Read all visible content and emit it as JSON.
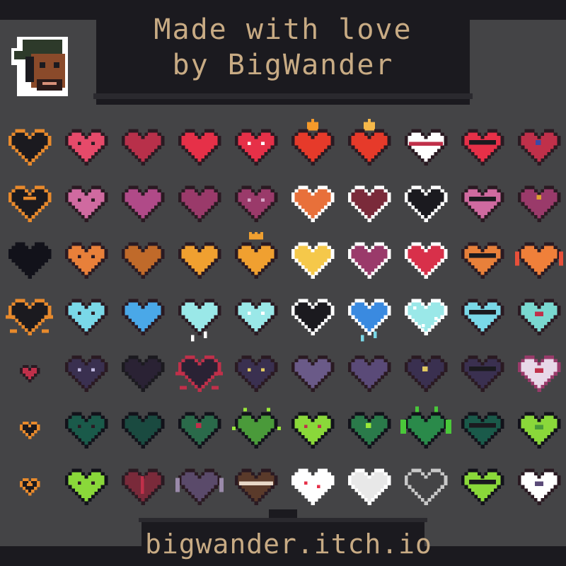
{
  "header": {
    "title_line1": "Made with love",
    "title_line2": "by BigWander"
  },
  "avatar": {
    "name": "avatar-icon"
  },
  "footer": {
    "url": "bigwander.itch.io"
  },
  "colors": {
    "outer_bg": "#1b1a1f",
    "panel_bg": "#444446",
    "panel_border": "#2a292e",
    "title_text": "#c8ab84",
    "plate_bg": "#1b1a1f"
  },
  "hearts": [
    [
      {
        "fill": "#1b1a1f",
        "outline": "#e88a2c"
      },
      {
        "fill": "#e64a6a",
        "outline": "#2a1a22",
        "eyes": "#2a1a22"
      },
      {
        "fill": "#b8304a",
        "outline": "#2a1a22"
      },
      {
        "fill": "#e63048",
        "outline": "#2a1a22"
      },
      {
        "fill": "#e63048",
        "outline": "#2a1a22",
        "eyes": "#ffffff"
      },
      {
        "fill": "#e63a2a",
        "outline": "#2a1a22",
        "flame": "#f59a2a"
      },
      {
        "fill": "#e63a2a",
        "outline": "#2a1a22",
        "flame": "#f5b84a"
      },
      {
        "fill": "#ffffff",
        "outline": "#2a1a22",
        "band": "#c0304a"
      },
      {
        "fill": "#e63048",
        "outline": "#2a1a22",
        "glasses": "#1b1a1f"
      },
      {
        "fill": "#c0304a",
        "outline": "#2a1a22",
        "eye": "#3a4aa8"
      }
    ],
    [
      {
        "fill": "#1b1a1f",
        "outline": "#e88a2c",
        "double": true
      },
      {
        "fill": "#d06aa0",
        "outline": "#2a1a22",
        "eyes": "#2a1a22"
      },
      {
        "fill": "#b04a88",
        "outline": "#2a1a22"
      },
      {
        "fill": "#9a3a6a",
        "outline": "#2a1a22"
      },
      {
        "fill": "#9a3a6a",
        "outline": "#2a1a22",
        "eyes": "#d8a8c8"
      },
      {
        "fill": "#e8703a",
        "outline": "#ffffff"
      },
      {
        "fill": "#7a2a3a",
        "outline": "#ffffff"
      },
      {
        "fill": "#1b1a1f",
        "outline": "#ffffff"
      },
      {
        "fill": "#d06aa0",
        "outline": "#2a1a22",
        "glasses": "#1b1a1f"
      },
      {
        "fill": "#9a3a6a",
        "outline": "#2a1a22",
        "bow": "#e0a030"
      }
    ],
    [
      {
        "fill": "#12121a",
        "outline": "#12121a"
      },
      {
        "fill": "#e8803a",
        "outline": "#2a1a22",
        "eyes": "#2a1a22"
      },
      {
        "fill": "#c06a2a",
        "outline": "#2a1a22"
      },
      {
        "fill": "#f0a030",
        "outline": "#2a1a22"
      },
      {
        "fill": "#f0a030",
        "outline": "#2a1a22",
        "crown": "#f0a030"
      },
      {
        "fill": "#f5c84a",
        "outline": "#ffffff"
      },
      {
        "fill": "#9a3a6a",
        "outline": "#ffffff"
      },
      {
        "fill": "#d8304a",
        "outline": "#ffffff"
      },
      {
        "fill": "#e8803a",
        "outline": "#2a1a22",
        "glasses": "#1b1a1f"
      },
      {
        "fill": "#f0803a",
        "outline": "#2a1a22",
        "wings": "#e8503a"
      }
    ],
    [
      {
        "fill": "#1b1a1f",
        "outline": "#e88a2c",
        "spikes": true
      },
      {
        "fill": "#7ad8e8",
        "outline": "#2a1a22",
        "eyes": "#2a1a22"
      },
      {
        "fill": "#4aa8e8",
        "outline": "#2a1a22"
      },
      {
        "fill": "#9ae8e8",
        "outline": "#2a1a22",
        "drip": "#ffffff"
      },
      {
        "fill": "#9ae8e8",
        "outline": "#2a1a22",
        "eyes": "#ffffff"
      },
      {
        "fill": "#1b1a1f",
        "outline": "#ffffff"
      },
      {
        "fill": "#3a8ae0",
        "outline": "#ffffff",
        "drip": "#7ad8e8"
      },
      {
        "fill": "#9ae8e8",
        "outline": "#ffffff",
        "frost": "#ffffff"
      },
      {
        "fill": "#7ad8e8",
        "outline": "#2a1a22",
        "glasses": "#1b1a1f"
      },
      {
        "fill": "#7ad8d0",
        "outline": "#2a1a22",
        "inner": "#c0304a"
      }
    ],
    [
      {
        "fill": "#c0304a",
        "outline": "#2a1a22",
        "small": true
      },
      {
        "fill": "#3a3050",
        "outline": "#2a1a22",
        "eyes": "#c0b8e0"
      },
      {
        "fill": "#2a2234",
        "outline": "#1b1a1f"
      },
      {
        "fill": "#2a2234",
        "outline": "#c0304a",
        "spikes": true
      },
      {
        "fill": "#3a3050",
        "outline": "#2a1a22",
        "eyes": "#e0c860"
      },
      {
        "fill": "#6a5a88",
        "outline": "#2a1a22"
      },
      {
        "fill": "#5a4a78",
        "outline": "#2a1a22"
      },
      {
        "fill": "#3a3050",
        "outline": "#2a1a22",
        "eye": "#e0c860"
      },
      {
        "fill": "#3a3050",
        "outline": "#2a1a22",
        "glasses": "#1b1a1f"
      },
      {
        "fill": "#e8d8e8",
        "outline": "#9a3a6a",
        "inner": "#c0304a"
      }
    ],
    [
      {
        "fill": "#1b1a1f",
        "outline": "#e88a2c",
        "small": true
      },
      {
        "fill": "#1a5a4a",
        "outline": "#12121a",
        "eyes": "#2a1a22"
      },
      {
        "fill": "#1a4a40",
        "outline": "#12121a"
      },
      {
        "fill": "#2a6a4a",
        "outline": "#12121a",
        "eye": "#c0304a"
      },
      {
        "fill": "#4a9a3a",
        "outline": "#12121a",
        "sparks": "#9ae83a"
      },
      {
        "fill": "#8ad83a",
        "outline": "#12121a",
        "eyes": "#c0304a"
      },
      {
        "fill": "#2a7a4a",
        "outline": "#12121a",
        "eye": "#9ae83a"
      },
      {
        "fill": "#2a8a4a",
        "outline": "#12121a",
        "vines": "#4ac83a"
      },
      {
        "fill": "#1a5a4a",
        "outline": "#12121a",
        "glasses": "#1b1a1f"
      },
      {
        "fill": "#8ad83a",
        "outline": "#12121a",
        "inner": "#4a9a3a"
      }
    ],
    [
      {
        "fill": "#1b1a1f",
        "outline": "#e88a2c",
        "small": true,
        "double": true
      },
      {
        "fill": "#8ad83a",
        "outline": "#12121a",
        "eyes": "#2a1a22"
      },
      {
        "fill": "#7a2a3a",
        "outline": "#2a1a22",
        "crack": "#c0304a"
      },
      {
        "fill": "#5a4a6a",
        "outline": "#2a1a22",
        "wings": "#9a8aaa"
      },
      {
        "fill": "#5a3a2a",
        "outline": "#2a1a22",
        "band": "#e8d8c8"
      },
      {
        "fill": "#ffffff",
        "outline": "#ffffff",
        "dots": "#e63048"
      },
      {
        "fill": "#e8e8e8",
        "outline": "#ffffff"
      },
      {
        "fill": "#444446",
        "outline": "#c8c8c8"
      },
      {
        "fill": "#8ad83a",
        "outline": "#12121a",
        "glasses": "#1b1a1f"
      },
      {
        "fill": "#ffffff",
        "outline": "#2a1a22",
        "inner": "#5a4a78"
      }
    ]
  ]
}
